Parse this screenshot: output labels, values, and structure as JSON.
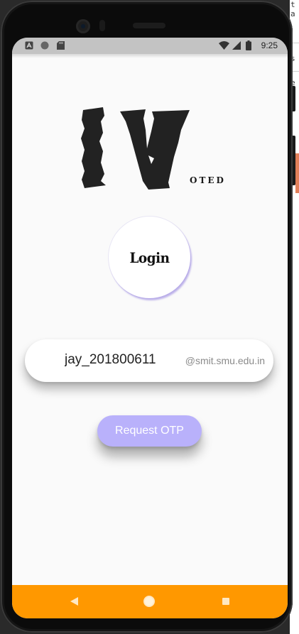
{
  "status_bar": {
    "time": "9:25",
    "left_icons": [
      "a-notification-icon",
      "circle-notification-icon",
      "sd-card-icon"
    ],
    "right_icons": [
      "wifi-icon",
      "signal-icon",
      "battery-icon"
    ]
  },
  "logo": {
    "main": "IV",
    "sub": "OTED"
  },
  "login_badge": {
    "label": "Login"
  },
  "username": {
    "value": "jay_201800611",
    "suffix": "@smit.smu.edu.in"
  },
  "actions": {
    "request_otp": "Request OTP"
  },
  "side_panel": {
    "fragments": [
      "t a",
      "s",
      "e"
    ]
  },
  "colors": {
    "accent": "#b9b1fb",
    "nav_bar": "#ff9800",
    "status_bar": "#c3c3c3",
    "screen_bg": "#fafafa"
  },
  "nav_bar": {
    "buttons": [
      "back-icon",
      "home-icon",
      "recents-icon"
    ]
  }
}
